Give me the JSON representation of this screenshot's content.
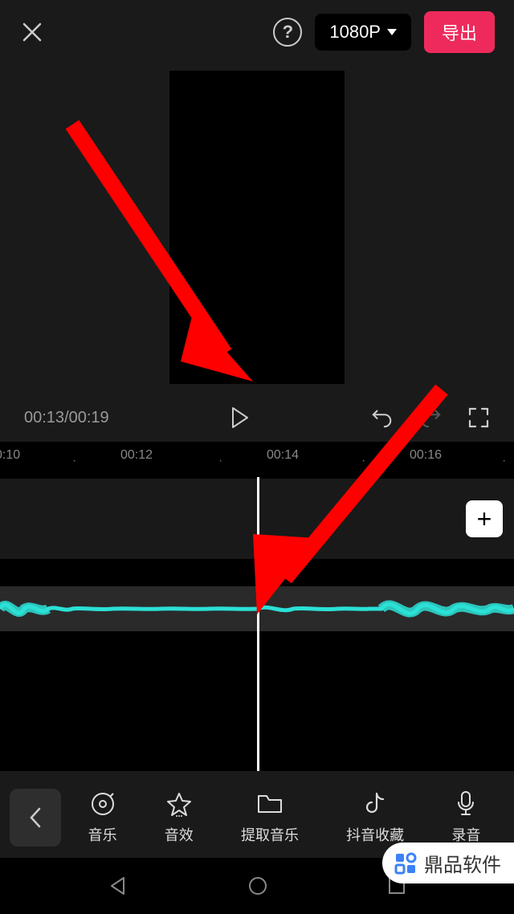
{
  "header": {
    "resolution_label": "1080P",
    "export_label": "导出"
  },
  "playback": {
    "current_time": "00:13",
    "total_time": "00:19"
  },
  "timeline": {
    "ticks": [
      "0:10",
      "00:12",
      "00:14",
      "00:16"
    ]
  },
  "toolbar": {
    "items": [
      {
        "id": "music",
        "label": "音乐"
      },
      {
        "id": "sound-effect",
        "label": "音效"
      },
      {
        "id": "extract-music",
        "label": "提取音乐"
      },
      {
        "id": "douyin-favorites",
        "label": "抖音收藏"
      },
      {
        "id": "record",
        "label": "录音"
      }
    ]
  },
  "watermark": {
    "text": "鼎品软件"
  },
  "colors": {
    "accent": "#ee2a5c",
    "waveform": "#2be0d6",
    "annotation": "#ff0000"
  }
}
